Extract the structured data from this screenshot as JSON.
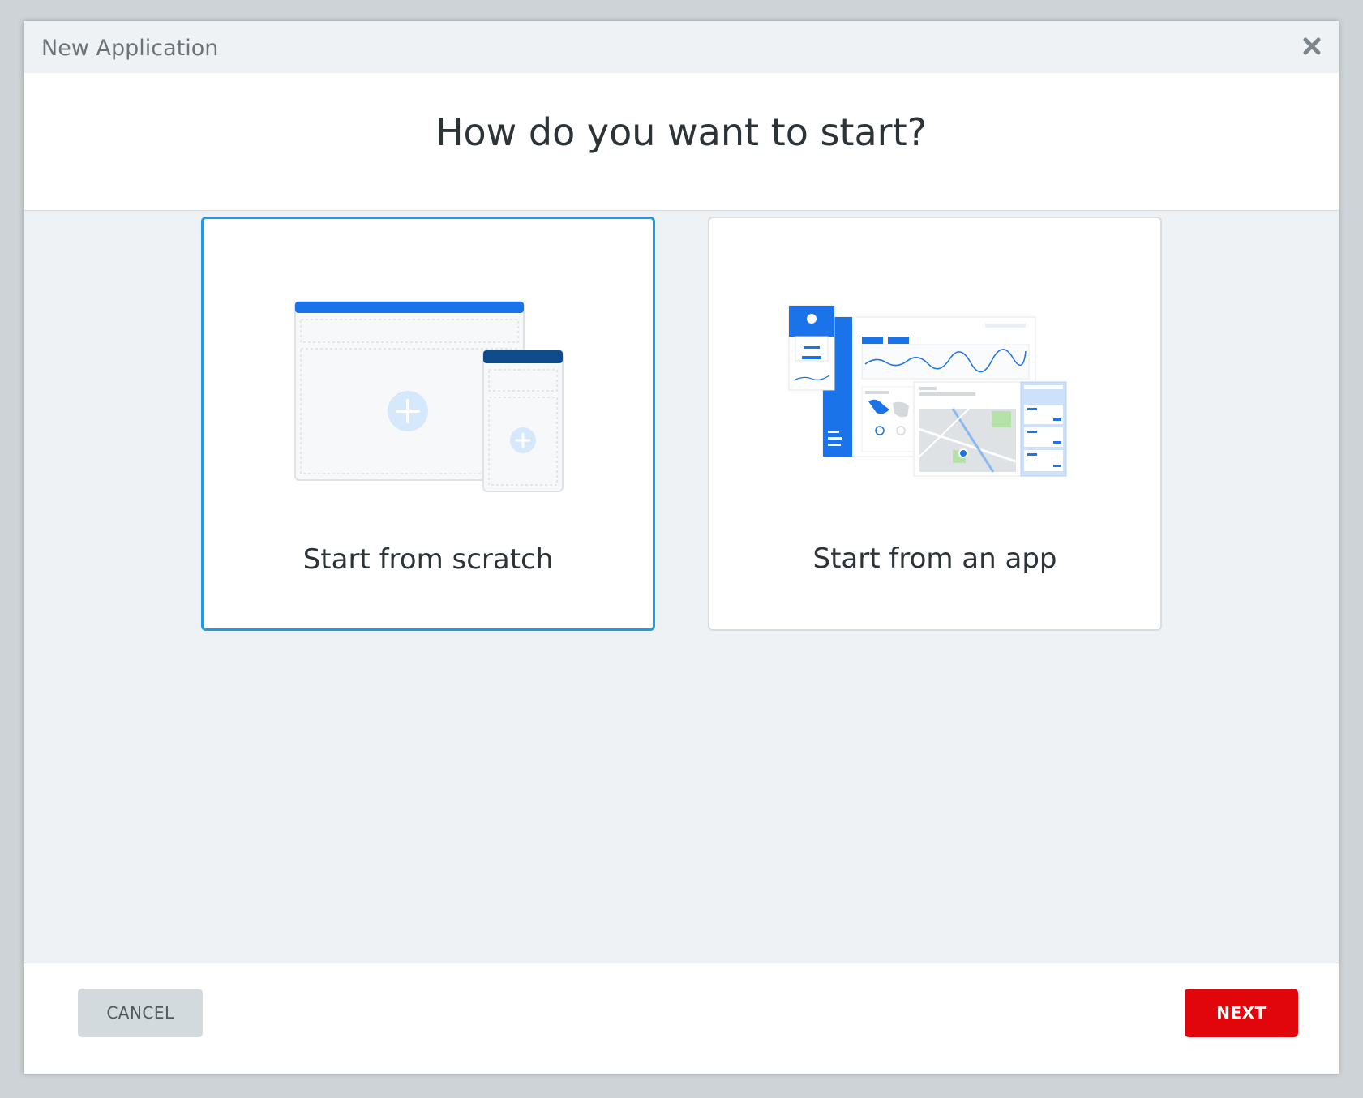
{
  "dialog": {
    "title": "New Application",
    "close_icon": "close-icon"
  },
  "heading": "How do you want to start?",
  "options": [
    {
      "label": "Start from scratch",
      "selected": true,
      "icon": "blank-layout-illustration"
    },
    {
      "label": "Start from an app",
      "selected": false,
      "icon": "app-template-illustration"
    }
  ],
  "footer": {
    "cancel_label": "CANCEL",
    "next_label": "NEXT"
  },
  "colors": {
    "accent": "#1e9be8",
    "primary_blue": "#1a73e8",
    "next_button": "#e1050c",
    "cancel_button": "#d3dade"
  }
}
